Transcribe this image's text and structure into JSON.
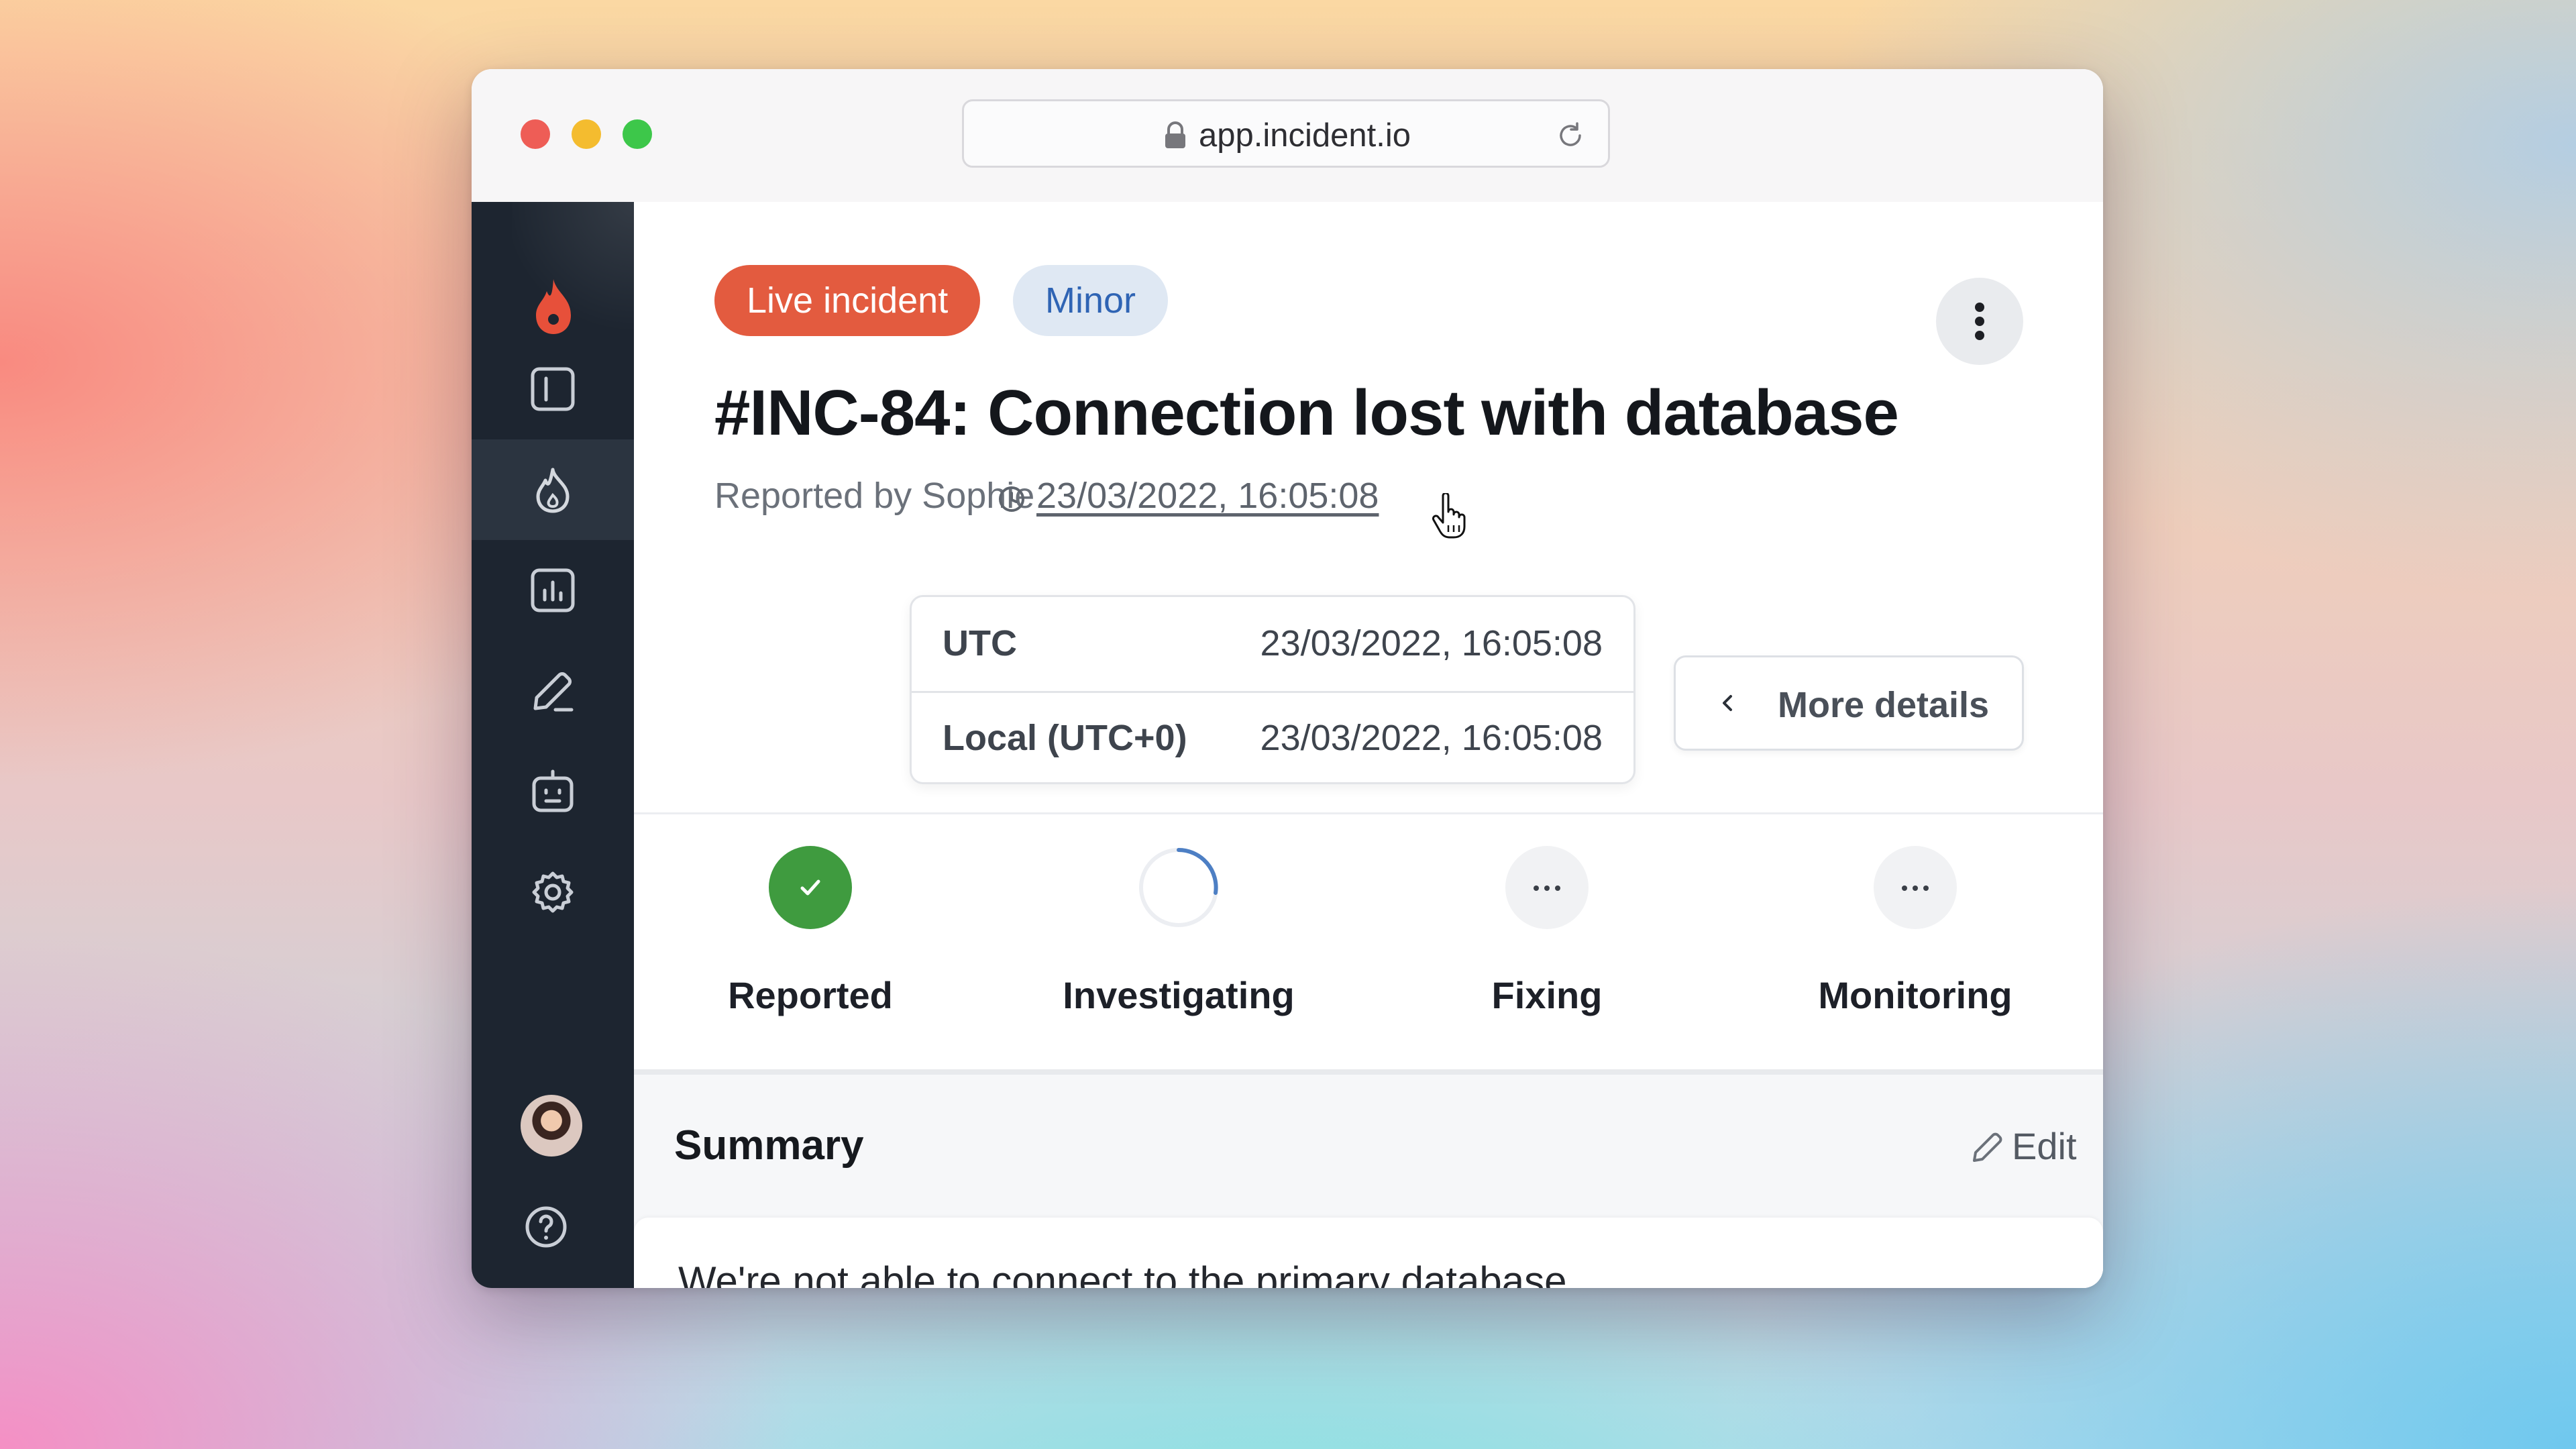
{
  "browser": {
    "url": "app.incident.io"
  },
  "sidebar": {
    "items": [
      {
        "icon": "sidebar-panel-icon",
        "active": false
      },
      {
        "icon": "incidents-flame-icon",
        "active": true
      },
      {
        "icon": "insights-chart-icon",
        "active": false
      },
      {
        "icon": "postmortem-pencil-icon",
        "active": false
      },
      {
        "icon": "workflows-bot-icon",
        "active": false
      },
      {
        "icon": "gear-icon",
        "active": false
      }
    ],
    "avatar": "user-avatar",
    "help_icon": "help-icon"
  },
  "incident": {
    "status_badge": "Live incident",
    "severity_badge": "Minor",
    "title": "#INC-84: Connection lost with database",
    "reported_by": "Reported by Sophie",
    "reported_at": "23/03/2022, 16:05:08"
  },
  "timezone_popover": {
    "rows": [
      {
        "label": "UTC",
        "value": "23/03/2022, 16:05:08"
      },
      {
        "label": "Local (UTC+0)",
        "value": "23/03/2022, 16:05:08"
      }
    ]
  },
  "more_details_label": "More details",
  "steps": [
    {
      "label": "Reported",
      "state": "done"
    },
    {
      "label": "Investigating",
      "state": "in-progress"
    },
    {
      "label": "Fixing",
      "state": "pending"
    },
    {
      "label": "Monitoring",
      "state": "pending"
    }
  ],
  "summary": {
    "heading": "Summary",
    "edit_label": "Edit",
    "text": "We're not able to connect to the primary database."
  },
  "colors": {
    "live_badge": "#e35b3f",
    "minor_badge_bg": "#dfe8f3",
    "minor_badge_text": "#2f64b4",
    "sidebar_bg": "#1d2530",
    "step_done": "#3f9b3f"
  }
}
